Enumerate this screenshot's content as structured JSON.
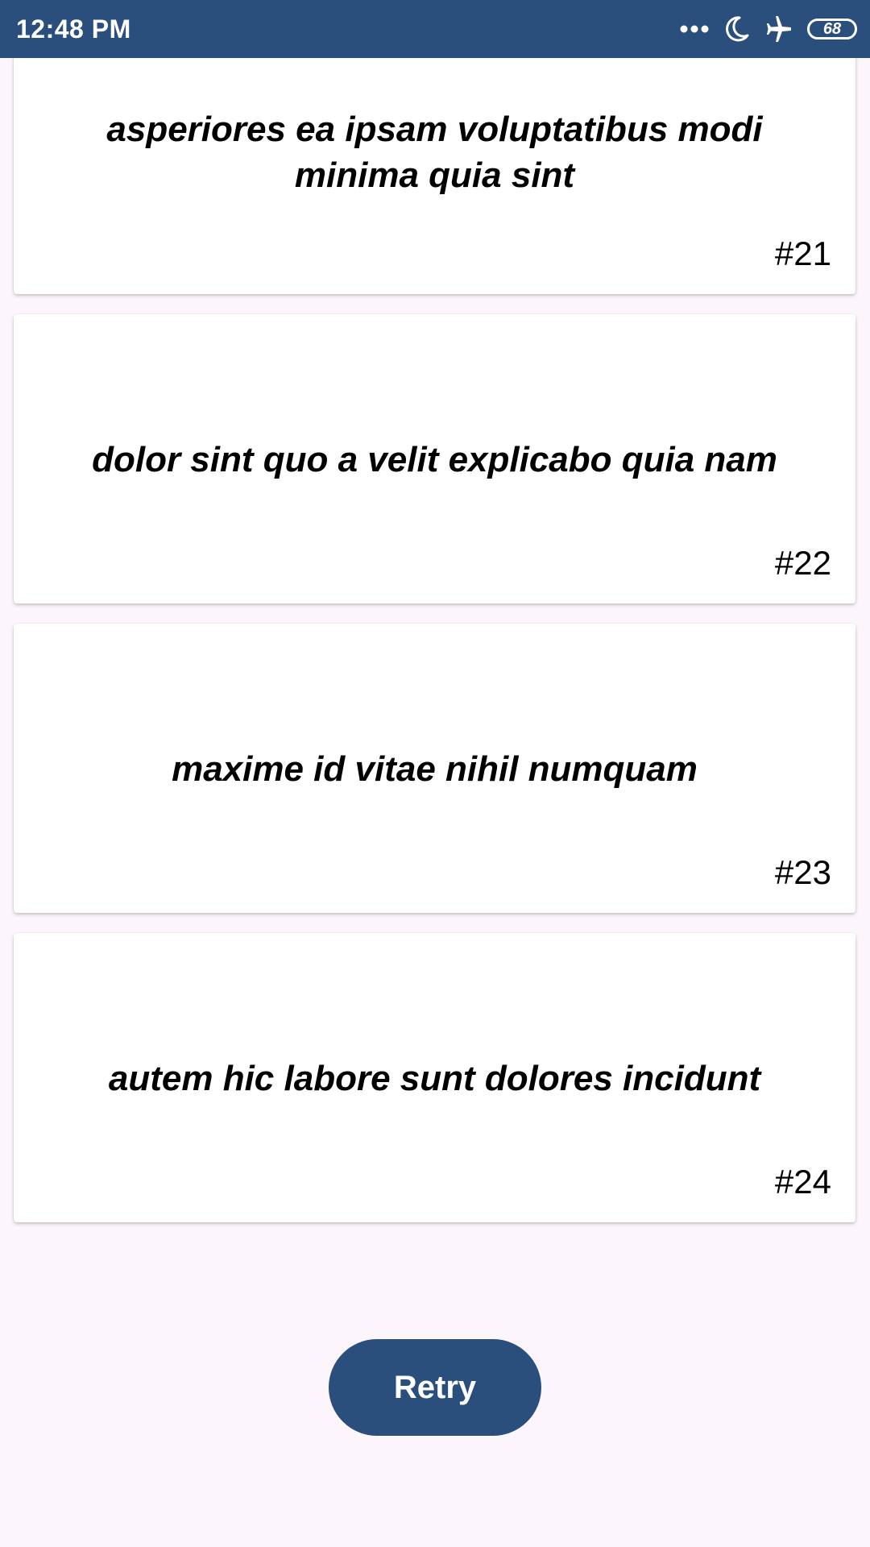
{
  "status_bar": {
    "time": "12:48 PM",
    "battery": "68",
    "icons": [
      "more-dots-icon",
      "moon-icon",
      "airplane-icon",
      "battery-icon"
    ],
    "background_color": "#2a4f7c"
  },
  "items": [
    {
      "title": "asperiores ea ipsam voluptatibus modi minima quia sint",
      "number": "#21"
    },
    {
      "title": "dolor sint quo a velit explicabo quia nam",
      "number": "#22"
    },
    {
      "title": "maxime id vitae nihil numquam",
      "number": "#23"
    },
    {
      "title": "autem hic labore sunt dolores incidunt",
      "number": "#24"
    }
  ],
  "retry_button": {
    "label": "Retry",
    "color": "#2a4f7c"
  },
  "page_background": "#fcf5fc"
}
